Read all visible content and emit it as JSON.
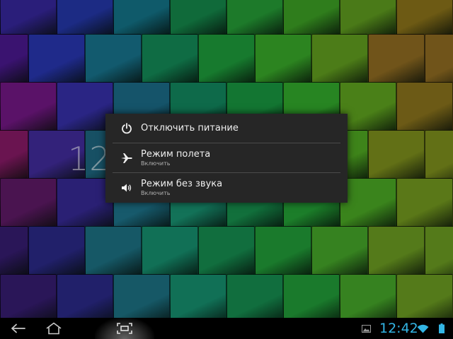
{
  "lockscreen": {
    "clock_partial": "12"
  },
  "power_menu": {
    "items": [
      {
        "icon": "power-icon",
        "title": "Отключить питание",
        "subtitle": ""
      },
      {
        "icon": "airplane-icon",
        "title": "Режим полета",
        "subtitle": "Включить"
      },
      {
        "icon": "speaker-icon",
        "title": "Режим без звука",
        "subtitle": "Включить"
      }
    ]
  },
  "navigation_bar": {
    "back_icon": "back-icon",
    "home_icon": "home-icon",
    "screenshot_icon": "screenshot-icon"
  },
  "status_bar": {
    "time": "12:42",
    "notification_icon": "image-notification-icon",
    "wifi_icon": "wifi-icon",
    "battery_icon": "battery-icon",
    "accent_color": "#33b5e5"
  }
}
